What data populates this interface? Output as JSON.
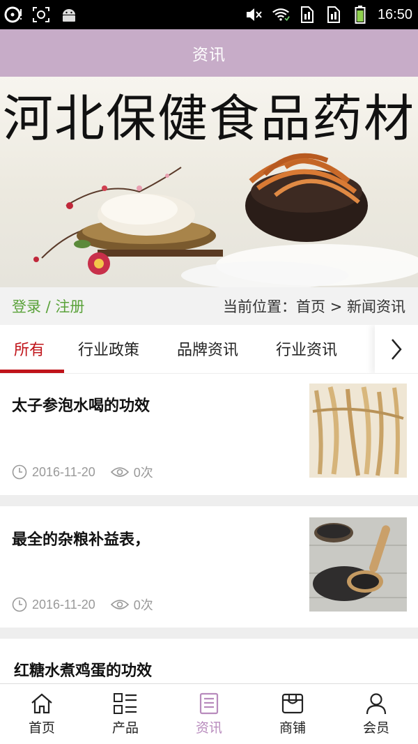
{
  "status_bar": {
    "time": "16:50"
  },
  "header": {
    "title": "资讯"
  },
  "banner": {
    "title": "河北保健食品药材"
  },
  "login": {
    "label": "登录 / 注册"
  },
  "breadcrumb": {
    "text": "当前位置：首页 > 新闻资讯"
  },
  "tabs": [
    "所有",
    "行业政策",
    "品牌资讯",
    "行业资讯"
  ],
  "articles": [
    {
      "title": "太子参泡水喝的功效",
      "date": "2016-11-20",
      "views": "0次",
      "thumb": "root-herb-thumbnail"
    },
    {
      "title": "最全的杂粮补益表，",
      "date": "2016-11-20",
      "views": "0次",
      "thumb": "black-grain-spoon-thumbnail"
    },
    {
      "title": "红糖水煮鸡蛋的功效"
    }
  ],
  "bottom_nav": [
    {
      "label": "首页",
      "icon": "home-icon"
    },
    {
      "label": "产品",
      "icon": "grid-list-icon"
    },
    {
      "label": "资讯",
      "icon": "document-icon",
      "active": true
    },
    {
      "label": "商铺",
      "icon": "shop-icon"
    },
    {
      "label": "会员",
      "icon": "user-icon"
    }
  ],
  "colors": {
    "header": "#c7acc8",
    "accent_red": "#c0141a",
    "login_green": "#5aa23a",
    "nav_active": "#b88bbd"
  }
}
